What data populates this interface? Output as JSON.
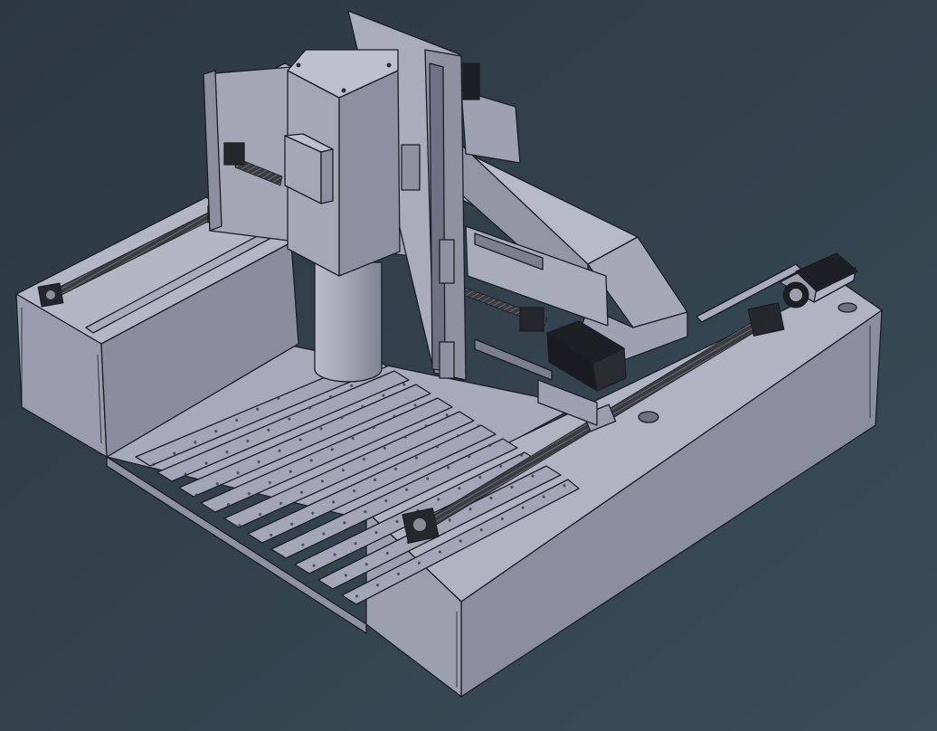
{
  "viewport": {
    "background_top": "#2c3741",
    "background_bottom": "#3a4d59",
    "colors": {
      "frame_light": "#b4b7c6",
      "frame_mid": "#9ea1b1",
      "frame_dark": "#7a7d8c",
      "table_top": "#a7aabb",
      "slat": "#a3a6b6",
      "motor": "#1e1f24",
      "motor_face": "#9c9fad",
      "ballscrew": "#35373d",
      "column": "#9fa2b2",
      "spindle": "#a4a7b6",
      "edge": "#1b1e24"
    }
  },
  "model": {
    "name": "cnc-gantry-router-assembly",
    "slat_count": 10,
    "icons": {
      "stepper_motor": "stepper-motor-icon",
      "ball_screw": "ball-screw-icon",
      "bearing_block": "bearing-block-icon",
      "spindle": "spindle-icon"
    }
  }
}
